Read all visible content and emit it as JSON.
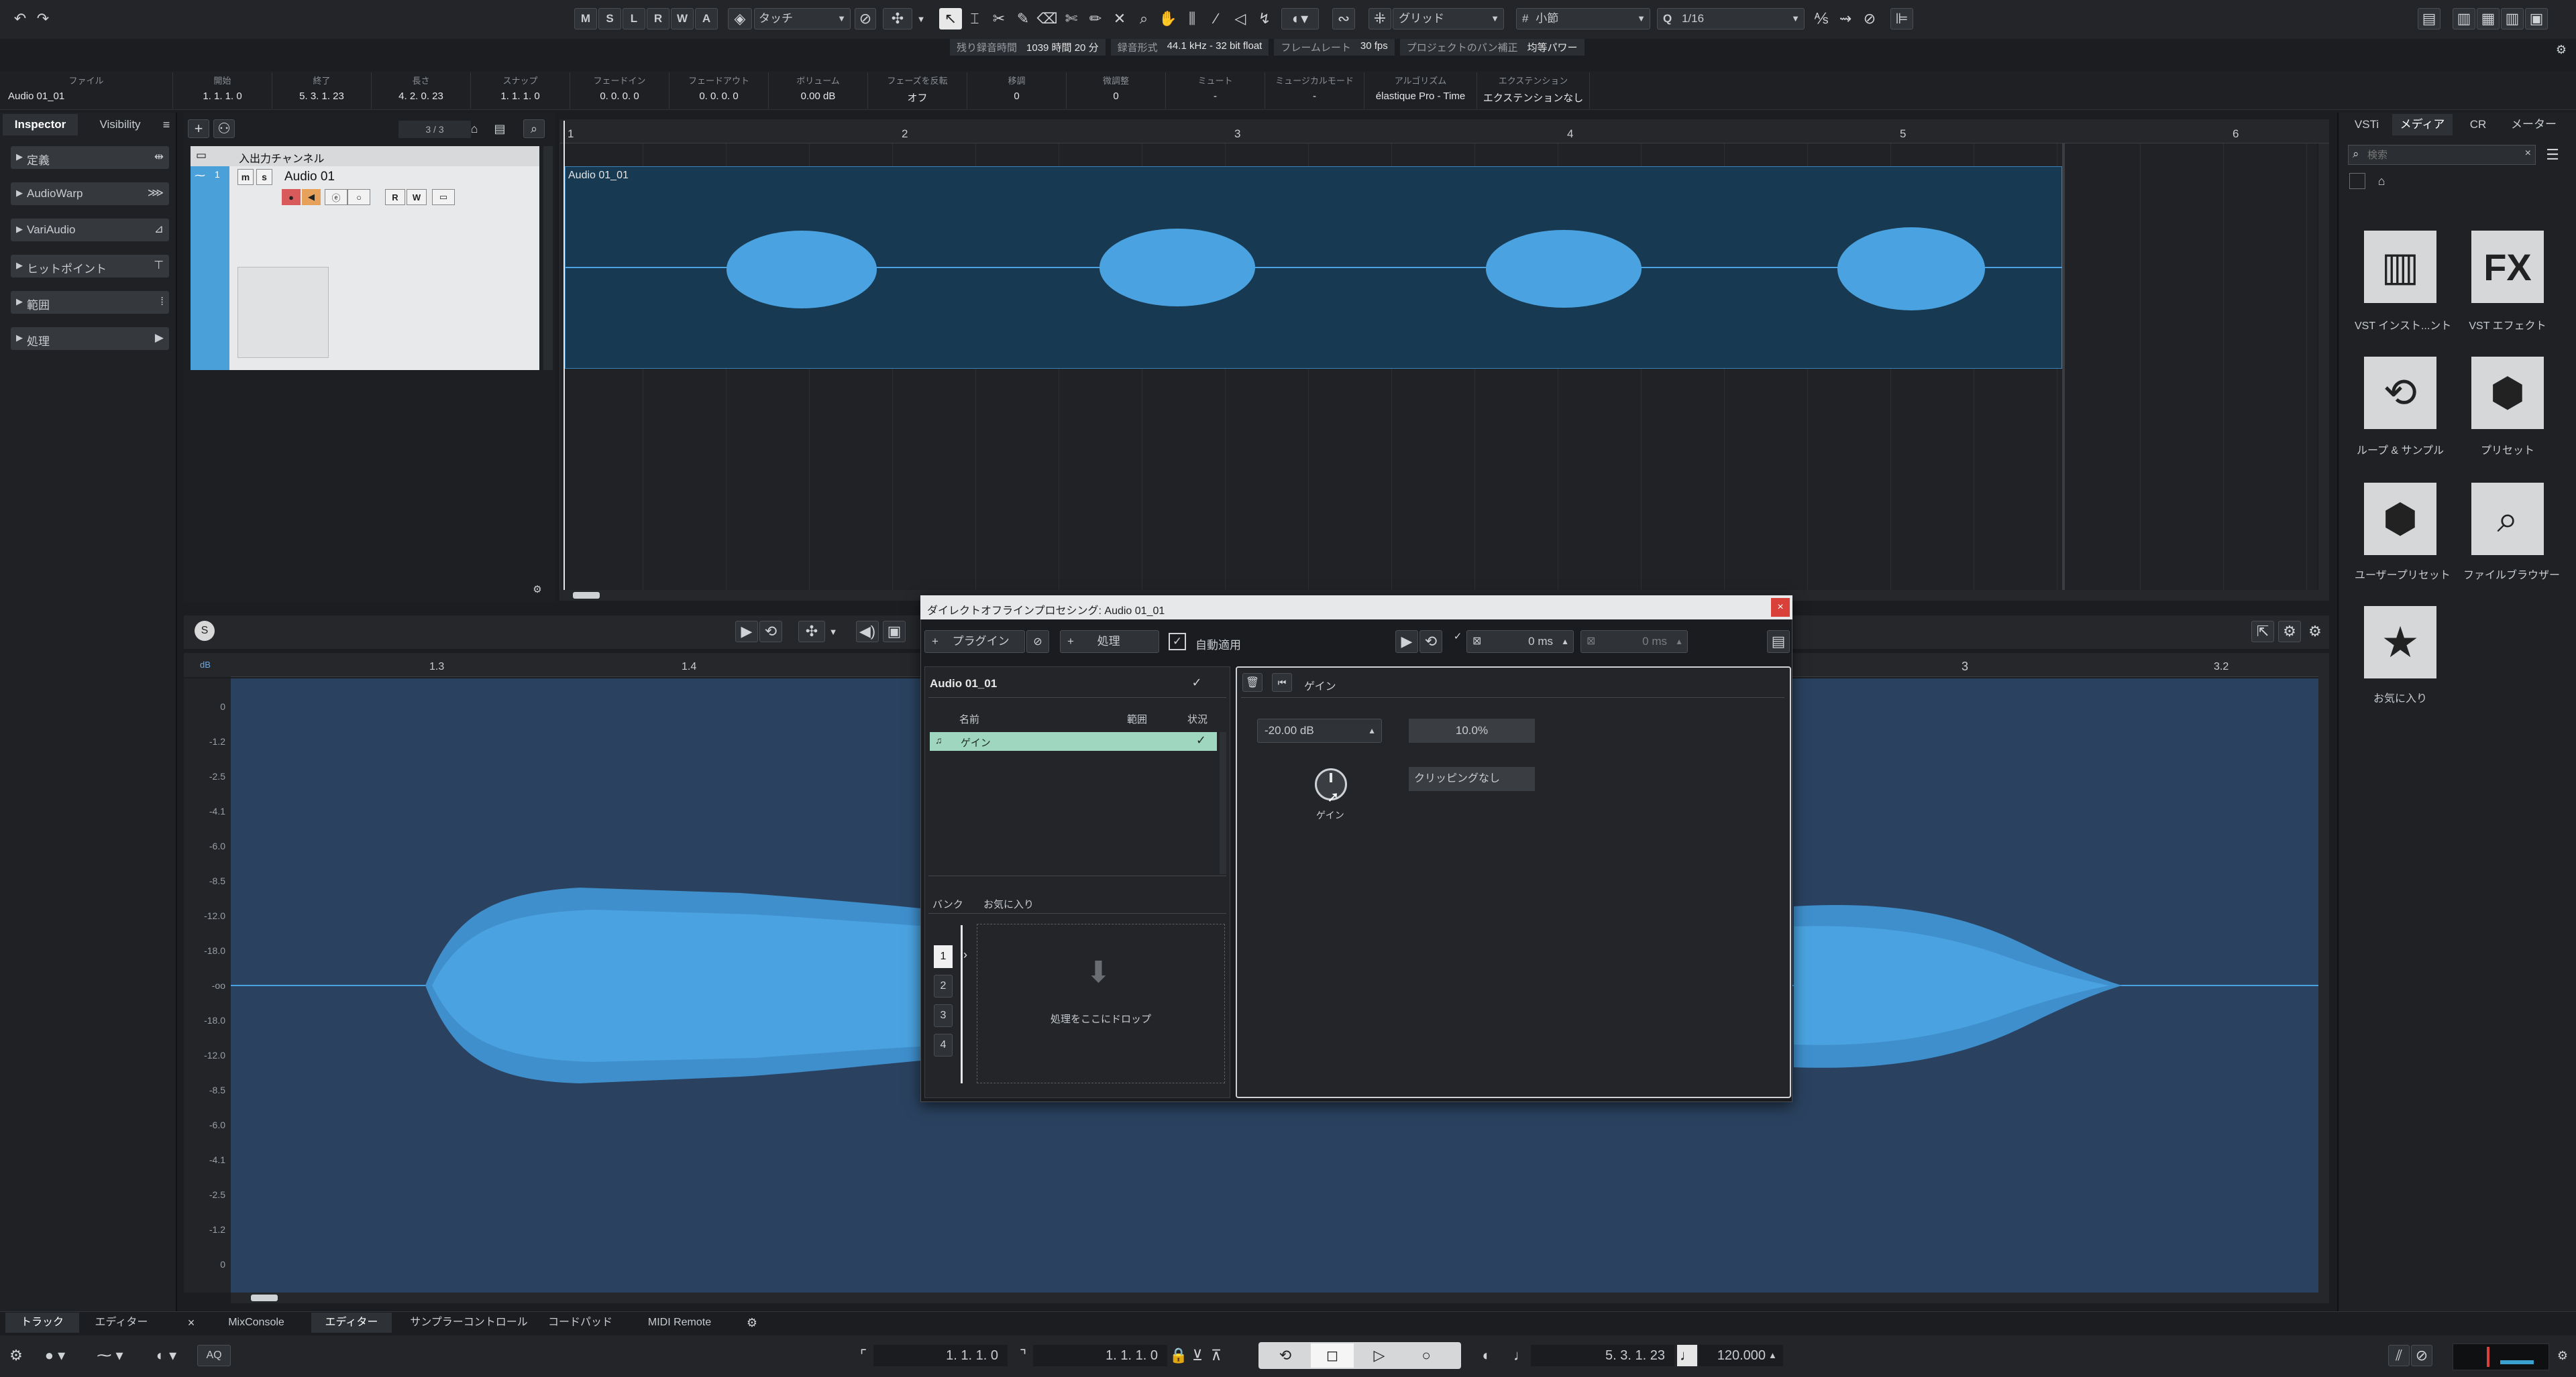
{
  "toolbar": {
    "msrwa": [
      "M",
      "S",
      "L",
      "R",
      "W",
      "A"
    ],
    "automation_mode": "タッチ",
    "snap_type": "グリッド",
    "grid_type": "小節",
    "quantize": "1/16"
  },
  "status_bar": {
    "rec_time_label": "残り録音時間",
    "rec_time": "1039 時間 20 分",
    "rec_format_label": "録音形式",
    "rec_format": "44.1 kHz - 32 bit float",
    "frame_rate_label": "フレームレート",
    "frame_rate": "30 fps",
    "pan_label": "プロジェクトのパン補正",
    "pan_value": "均等パワー"
  },
  "info_line": {
    "fields": [
      {
        "label": "ファイル",
        "value": "Audio 01_01"
      },
      {
        "label": "開始",
        "value": "1. 1. 1.   0"
      },
      {
        "label": "終了",
        "value": "5. 3. 1. 23"
      },
      {
        "label": "長さ",
        "value": "4. 2. 0. 23"
      },
      {
        "label": "スナップ",
        "value": "1. 1. 1.   0"
      },
      {
        "label": "フェードイン",
        "value": "0. 0. 0.   0"
      },
      {
        "label": "フェードアウト",
        "value": "0. 0. 0.   0"
      },
      {
        "label": "ボリューム",
        "value": "0.00      dB"
      },
      {
        "label": "フェーズを反転",
        "value": "オフ"
      },
      {
        "label": "移調",
        "value": "0"
      },
      {
        "label": "微調整",
        "value": "0"
      },
      {
        "label": "ミュート",
        "value": "-"
      },
      {
        "label": "ミュージカルモード",
        "value": "-"
      },
      {
        "label": "アルゴリズム",
        "value": "élastique Pro - Time"
      },
      {
        "label": "エクステンション",
        "value": "エクステンションなし"
      }
    ]
  },
  "inspector": {
    "tabs": [
      "Inspector",
      "Visibility"
    ],
    "sections": [
      "定義",
      "AudioWarp",
      "VariAudio",
      "ヒットポイント",
      "範囲",
      "処理"
    ]
  },
  "project": {
    "track_count": "3 / 3",
    "folder_name": "入出力チャンネル",
    "track_name": "Audio 01",
    "event_name": "Audio 01_01",
    "ruler": [
      "1",
      "2",
      "3",
      "4",
      "5",
      "6"
    ]
  },
  "editor": {
    "ruler": [
      "1.3",
      "1.4",
      "3",
      "3.2"
    ],
    "db_unit": "dB",
    "db_scale": [
      "0",
      "-1.2",
      "-2.5",
      "-4.1",
      "-6.0",
      "-8.5",
      "-12.0",
      "-18.0",
      "-oo",
      "-18.0",
      "-12.0",
      "-8.5",
      "-6.0",
      "-4.1",
      "-2.5",
      "-1.2",
      "0"
    ]
  },
  "dop": {
    "title": "ダイレクトオフラインプロセシング: Audio 01_01",
    "plugin_btn": "プラグイン",
    "process_btn": "処理",
    "auto_apply": "自動適用",
    "ms1": "0 ms",
    "ms2": "0 ms",
    "clip_name": "Audio 01_01",
    "col_name": "名前",
    "col_range": "範囲",
    "col_status": "状況",
    "process_item": "ゲイン",
    "bank_label": "バンク",
    "fav_label": "お気に入り",
    "banks": [
      "1",
      "2",
      "3",
      "4"
    ],
    "drop_text": "処理をここにドロップ",
    "panel_title": "ゲイン",
    "gain_value": "-20.00 dB",
    "gain_pct": "10.0%",
    "clip_status": "クリッピングなし",
    "knob_label": "ゲイン"
  },
  "media": {
    "tabs": [
      "VSTi",
      "メディア",
      "CR",
      "メーター"
    ],
    "search_placeholder": "検索",
    "tiles": [
      {
        "label": "VST インスト...ント",
        "icon": "piano-icon"
      },
      {
        "label": "VST エフェクト",
        "icon": "fx-icon"
      },
      {
        "label": "ループ & サンプル",
        "icon": "loop-icon"
      },
      {
        "label": "プリセット",
        "icon": "preset-icon"
      },
      {
        "label": "ユーザープリセット",
        "icon": "user-preset-icon"
      },
      {
        "label": "ファイルブラウザー",
        "icon": "file-browser-icon"
      },
      {
        "label": "お気に入り",
        "icon": "star-icon"
      }
    ]
  },
  "lower_tabs": {
    "left": [
      "トラック",
      "エディター"
    ],
    "right": [
      "MixConsole",
      "エディター",
      "サンプラーコントロール",
      "コードパッド",
      "MIDI Remote"
    ]
  },
  "transport": {
    "aq": "AQ",
    "left_locator": "1. 1. 1.   0",
    "right_locator": "1. 1. 1.   0",
    "position": "5. 3. 1. 23",
    "tempo": "120.000"
  }
}
